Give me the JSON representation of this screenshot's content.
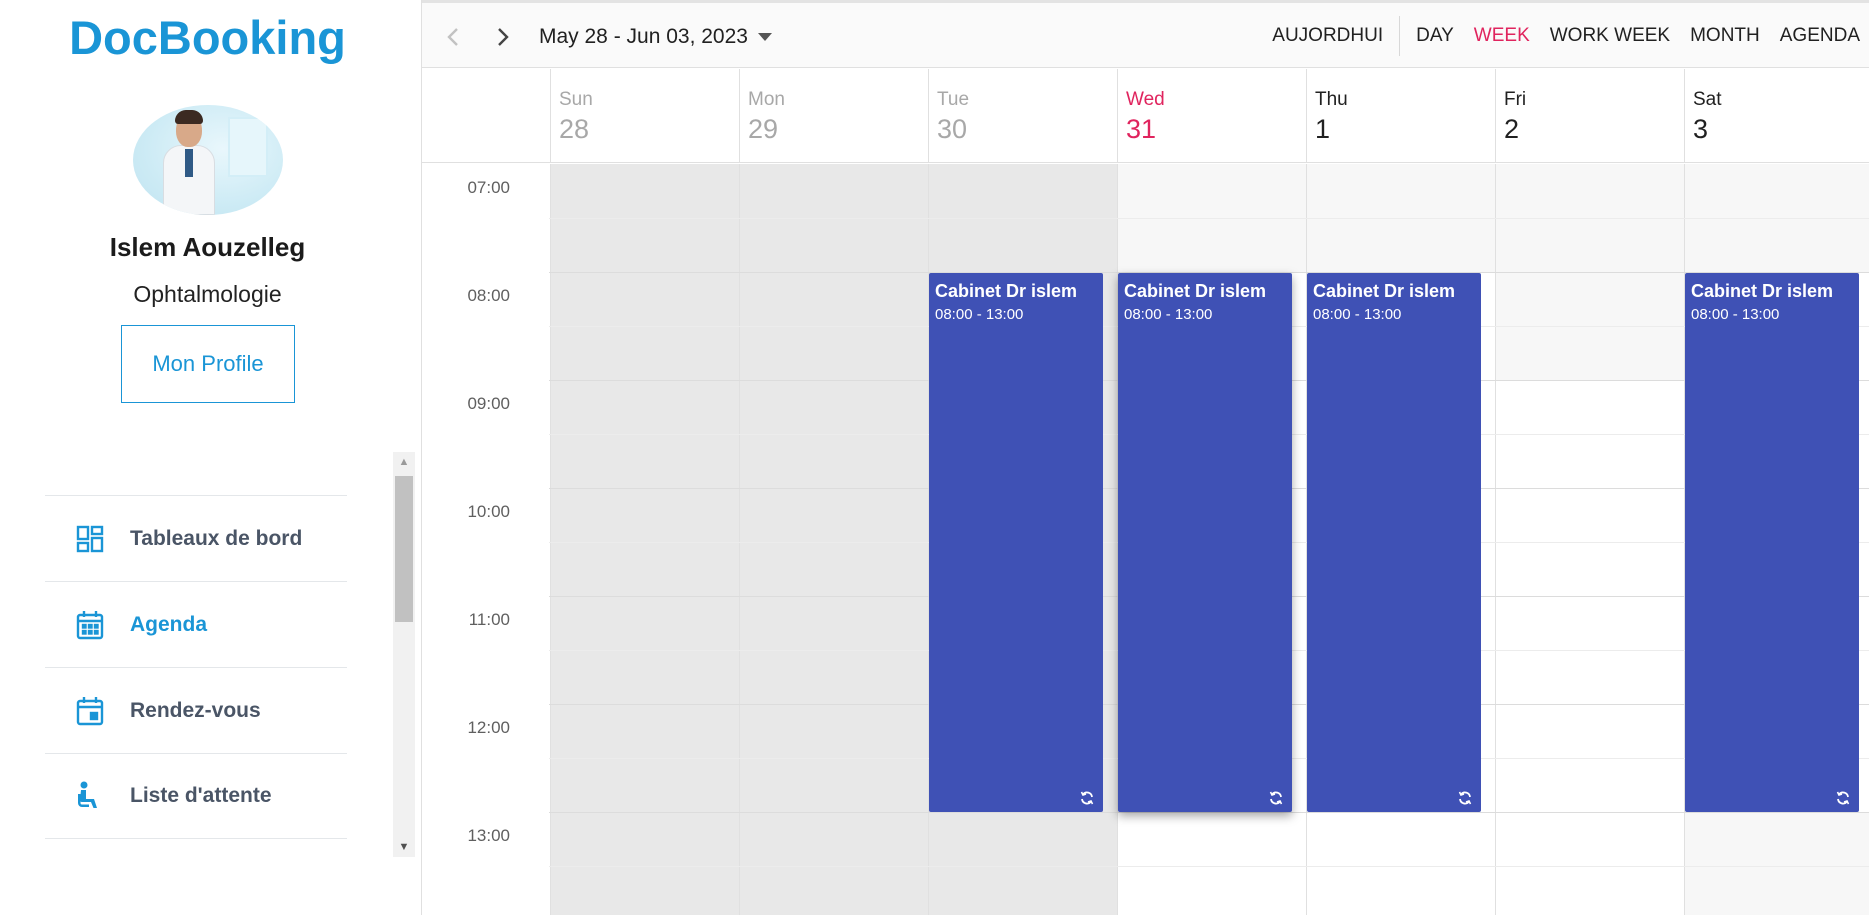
{
  "brand": {
    "name": "DocBooking",
    "color": "#1a95d6"
  },
  "doctor": {
    "name": "Islem Aouzelleg",
    "specialty": "Ophtalmologie",
    "profile_button": "Mon Profile"
  },
  "menu": [
    {
      "label": "Tableaux de bord",
      "icon": "dashboard-icon",
      "active": false
    },
    {
      "label": "Agenda",
      "icon": "calendar-icon",
      "active": true
    },
    {
      "label": "Rendez-vous",
      "icon": "calendar-event-icon",
      "active": false
    },
    {
      "label": "Liste d'attente",
      "icon": "waiting-seat-icon",
      "active": false
    }
  ],
  "toolbar": {
    "date_range": "May 28 - Jun 03, 2023",
    "today": "AUJORDHUI",
    "views": [
      "DAY",
      "WEEK",
      "WORK WEEK",
      "MONTH",
      "AGENDA"
    ],
    "active_view": "WEEK"
  },
  "days": [
    {
      "name": "Sun",
      "num": "28",
      "state": "past"
    },
    {
      "name": "Mon",
      "num": "29",
      "state": "past"
    },
    {
      "name": "Tue",
      "num": "30",
      "state": "past"
    },
    {
      "name": "Wed",
      "num": "31",
      "state": "today"
    },
    {
      "name": "Thu",
      "num": "1",
      "state": "future"
    },
    {
      "name": "Fri",
      "num": "2",
      "state": "future"
    },
    {
      "name": "Sat",
      "num": "3",
      "state": "future"
    }
  ],
  "hours": [
    "07:00",
    "08:00",
    "09:00",
    "10:00",
    "11:00",
    "12:00",
    "13:00"
  ],
  "events": [
    {
      "day": 2,
      "title": "Cabinet Dr islem",
      "time": "08:00 - 13:00",
      "start": "08:00",
      "end": "13:00",
      "recurring": true
    },
    {
      "day": 3,
      "title": "Cabinet Dr islem",
      "time": "08:00 - 13:00",
      "start": "08:00",
      "end": "13:00",
      "recurring": true,
      "selected": true
    },
    {
      "day": 4,
      "title": "Cabinet Dr islem",
      "time": "08:00 - 13:00",
      "start": "08:00",
      "end": "13:00",
      "recurring": true
    },
    {
      "day": 6,
      "title": "Cabinet Dr islem",
      "time": "08:00 - 13:00",
      "start": "08:00",
      "end": "13:00",
      "recurring": true
    }
  ],
  "colors": {
    "event": "#3f51b5",
    "today": "#e0245e",
    "accent": "#1a95d6",
    "non_work": "#e8e8e8",
    "work_off": "#f7f7f7"
  }
}
